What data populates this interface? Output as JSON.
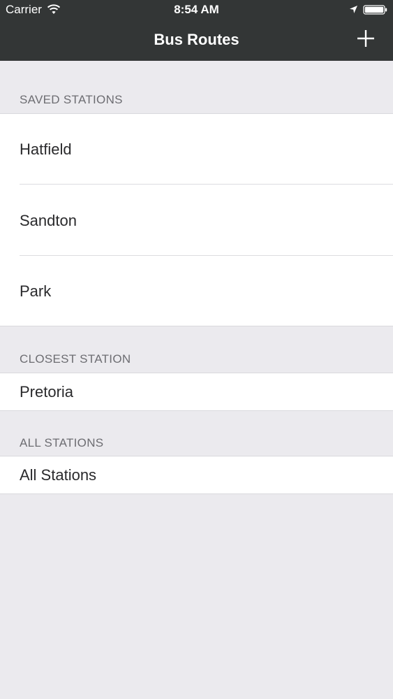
{
  "status_bar": {
    "carrier": "Carrier",
    "time": "8:54 AM",
    "wifi_icon": "wifi-icon",
    "location_icon": "location-arrow-icon",
    "battery_icon": "battery-icon"
  },
  "nav": {
    "title": "Bus Routes",
    "add_icon": "plus-icon",
    "bar_color": "#333636"
  },
  "sections": {
    "saved": {
      "header": "SAVED STATIONS",
      "items": [
        "Hatfield",
        "Sandton",
        "Park"
      ]
    },
    "closest": {
      "header": "CLOSEST STATION",
      "item": "Pretoria"
    },
    "all": {
      "header": "ALL STATIONS",
      "item": "All Stations"
    }
  },
  "colors": {
    "background": "#ebeaee",
    "header_text": "#6d6d72",
    "row_text": "#2a2a2c"
  }
}
